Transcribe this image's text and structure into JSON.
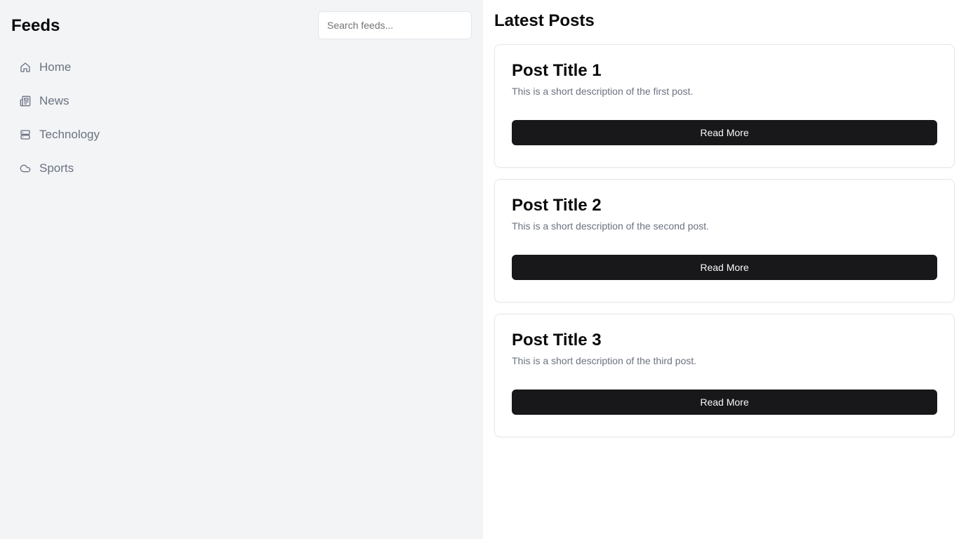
{
  "sidebar": {
    "title": "Feeds",
    "search": {
      "placeholder": "Search feeds...",
      "value": ""
    },
    "items": [
      {
        "label": "Home",
        "icon": "home-icon"
      },
      {
        "label": "News",
        "icon": "newspaper-icon"
      },
      {
        "label": "Technology",
        "icon": "server-icon"
      },
      {
        "label": "Sports",
        "icon": "cloud-icon"
      }
    ]
  },
  "main": {
    "title": "Latest Posts",
    "posts": [
      {
        "title": "Post Title 1",
        "description": "This is a short description of the first post.",
        "button": "Read More"
      },
      {
        "title": "Post Title 2",
        "description": "This is a short description of the second post.",
        "button": "Read More"
      },
      {
        "title": "Post Title 3",
        "description": "This is a short description of the third post.",
        "button": "Read More"
      }
    ]
  },
  "colors": {
    "sidebar_bg": "#f2f4f6",
    "button_bg": "#18181b",
    "muted_text": "#6b7280"
  }
}
